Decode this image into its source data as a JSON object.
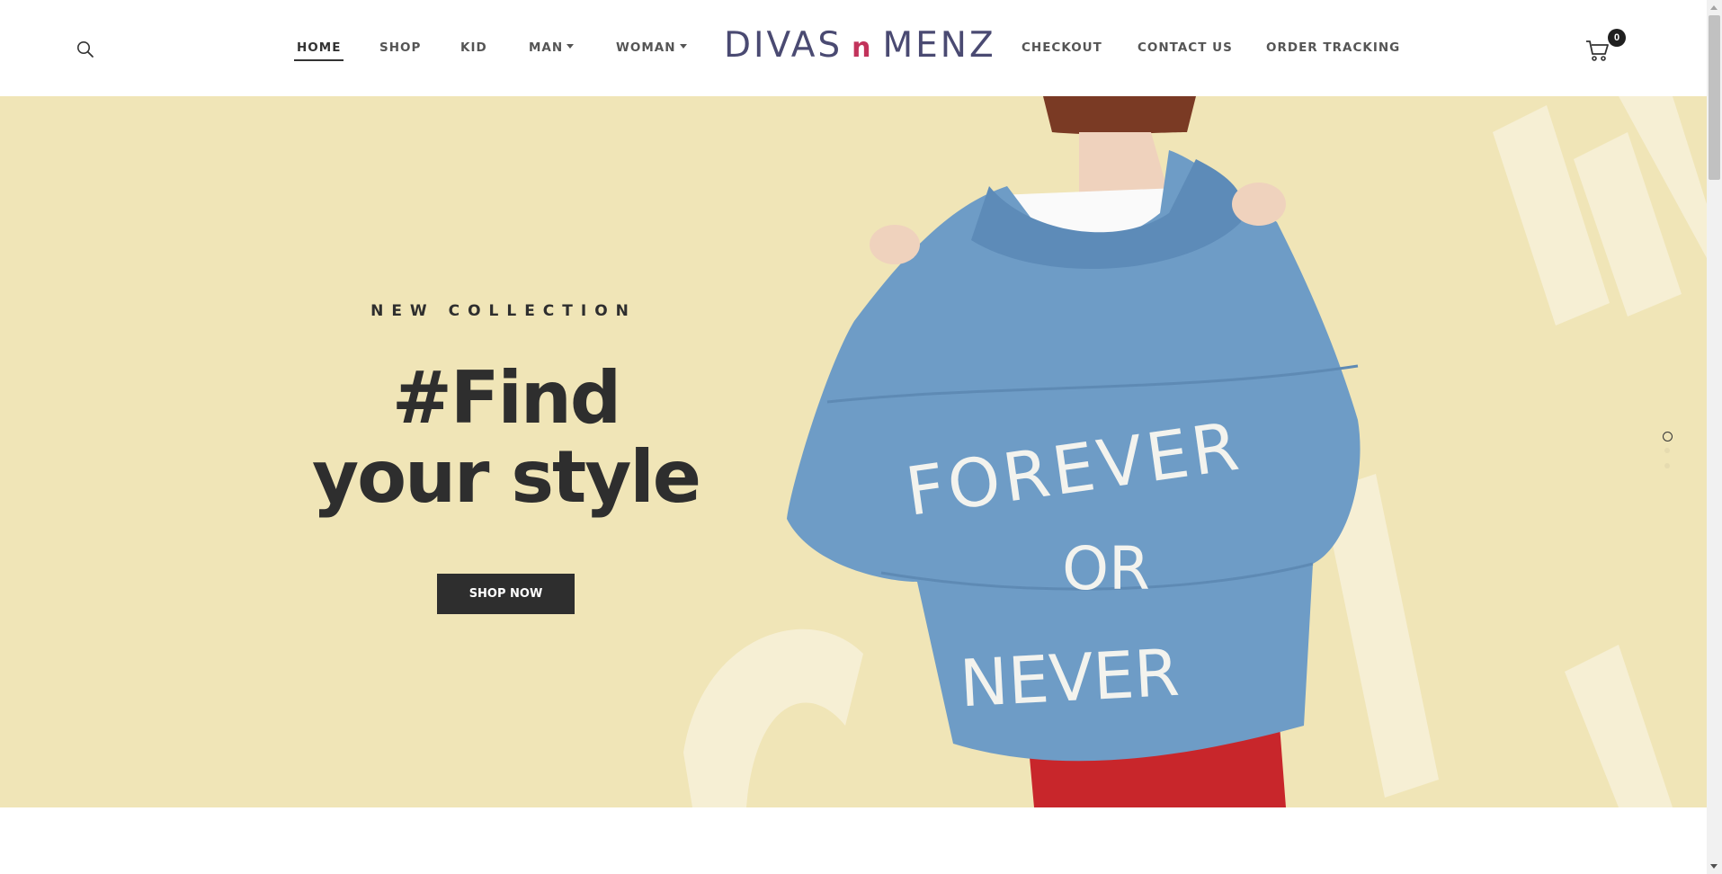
{
  "header": {
    "nav": {
      "home": "HOME",
      "shop": "SHOP",
      "kid": "KID",
      "man": "MAN",
      "woman": "WOMAN",
      "checkout": "CHECKOUT",
      "contact": "CONTACT US",
      "tracking": "ORDER TRACKING"
    },
    "logo": {
      "part1": "DIVAS",
      "part2": "n",
      "part3": "MENZ"
    },
    "cart_count": "0",
    "icons": {
      "search": "search-icon",
      "cart": "cart-icon",
      "dropdown": "caret-down-icon"
    }
  },
  "hero": {
    "subtitle": "NEW COLLECTION",
    "headline_line1": "#Find",
    "headline_line2": "your style",
    "button_label": "SHOP NOW",
    "jacket_text_line1": "FOREVER",
    "jacket_text_line2": "OR",
    "jacket_text_line3": "NEVER",
    "slides_total": 3,
    "active_slide": 1
  },
  "colors": {
    "hero_background": "#f0e5b7",
    "text_dark": "#2e2e2e",
    "logo_navy": "#4a4a72",
    "logo_accent": "#c2335b",
    "denim": "#6e9cc6"
  }
}
